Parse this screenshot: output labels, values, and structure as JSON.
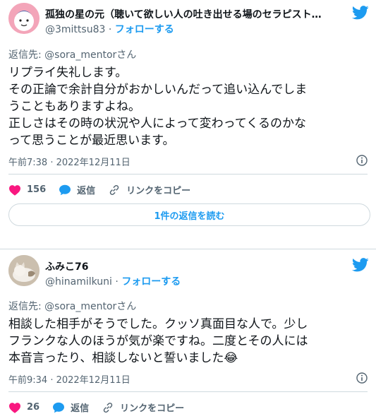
{
  "tweet1": {
    "name": "孤独の星の元（聴いて欲しい人の吐き出せる場のセラピスト…",
    "handle": "@3mittsu83",
    "separator": "·",
    "follow": "フォローする",
    "reply_to": "返信先: @sora_mentorさん",
    "text": "リプライ失礼します。\nその正論で余計自分がおかしいんだって追い込んでしま\nうこともありますよね。\n正しさはその時の状況や人によって変わってくるのかな\nって思うことが最近思います。",
    "timestamp": "午前7:38 · 2022年12月11日",
    "likes": "156",
    "reply_label": "返信",
    "copy_link_label": "リンクをコピー",
    "read_replies": "1件の返信を読む"
  },
  "tweet2": {
    "name": "ふみこ76",
    "handle": "@hinamilkuni",
    "separator": "·",
    "follow": "フォローする",
    "reply_to": "返信先: @sora_mentorさん",
    "text": "相談した相手がそうでした。クッソ真面目な人で。少し\nフランクな人のほうが気が楽ですね。二度とその人には\n本音言ったり、相談しないと誓いました",
    "emoji": "😂",
    "timestamp": "午前9:34 · 2022年12月11日",
    "likes": "26",
    "reply_label": "返信",
    "copy_link_label": "リンクをコピー"
  },
  "colors": {
    "accent": "#1d9bf0",
    "like": "#f91880",
    "muted": "#536471"
  }
}
